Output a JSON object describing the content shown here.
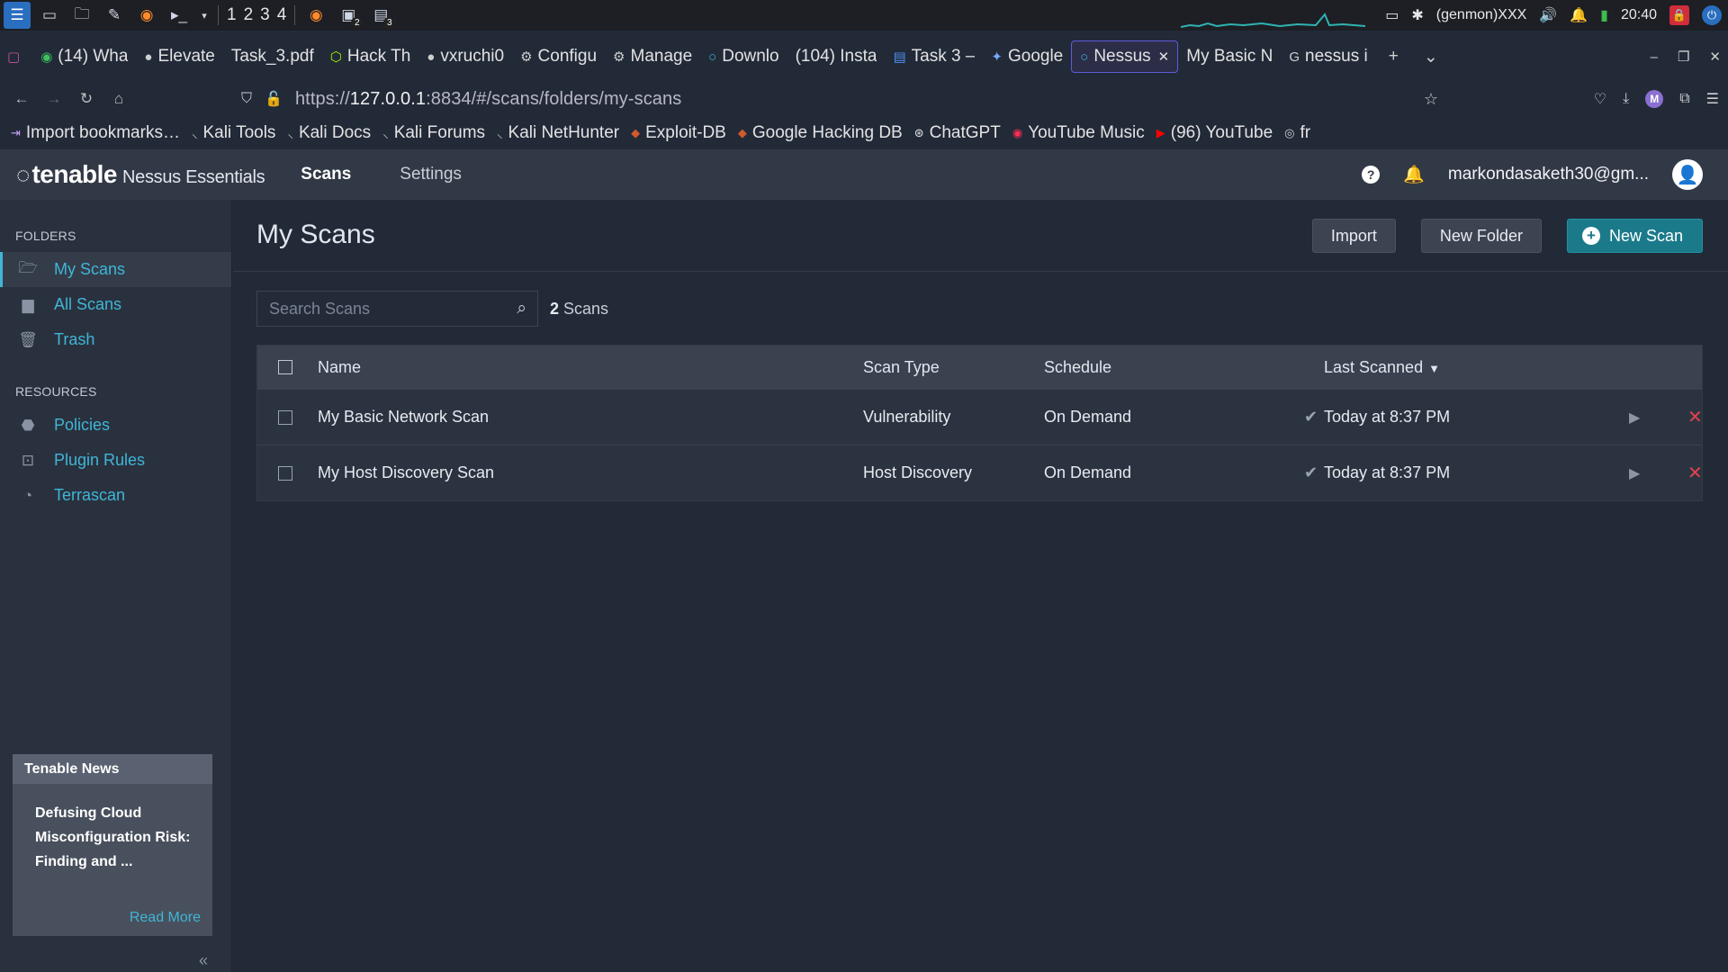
{
  "taskbar": {
    "workspaces": [
      "1",
      "2",
      "3",
      "4"
    ],
    "genmon": "(genmon)XXX",
    "clock": "20:40",
    "terminal_badge": "2",
    "files_badge": "3"
  },
  "tabs": [
    {
      "label": "(14) Wha",
      "icon": "whatsapp-icon"
    },
    {
      "label": "Elevate",
      "icon": "github-icon"
    },
    {
      "label": "Task_3.pdf",
      "icon": "pdf-icon"
    },
    {
      "label": "Hack Th",
      "icon": "hackthebox-icon"
    },
    {
      "label": "vxruchi0",
      "icon": "github-icon"
    },
    {
      "label": "Configu",
      "icon": "gear-icon"
    },
    {
      "label": "Manage",
      "icon": "gear-icon"
    },
    {
      "label": "Downlo",
      "icon": "nessus-icon"
    },
    {
      "label": "(104) Insta",
      "icon": "instagram-icon"
    },
    {
      "label": "Task 3 –",
      "icon": "docs-icon"
    },
    {
      "label": "Google",
      "icon": "gemini-icon"
    },
    {
      "label": "Nessus",
      "icon": "nessus-icon",
      "active": true
    },
    {
      "label": "My Basic N",
      "icon": ""
    },
    {
      "label": "nessus i",
      "icon": "google-icon"
    }
  ],
  "url": {
    "prefix": "https://",
    "host": "127.0.0.1",
    "rest": ":8834/#/scans/folders/my-scans"
  },
  "bookmarks": [
    "Import bookmarks…",
    "Kali Tools",
    "Kali Docs",
    "Kali Forums",
    "Kali NetHunter",
    "Exploit-DB",
    "Google Hacking DB",
    "ChatGPT",
    "YouTube Music",
    "(96) YouTube",
    "fr"
  ],
  "app": {
    "brand": "tenable",
    "product": "Nessus Essentials",
    "nav": {
      "scans": "Scans",
      "settings": "Settings"
    },
    "user_email": "markondasaketh30@gm..."
  },
  "sidebar": {
    "folders_heading": "FOLDERS",
    "folders": [
      {
        "label": "My Scans",
        "icon": "folder-open-icon"
      },
      {
        "label": "All Scans",
        "icon": "folder-icon"
      },
      {
        "label": "Trash",
        "icon": "trash-icon"
      }
    ],
    "resources_heading": "RESOURCES",
    "resources": [
      {
        "label": "Policies",
        "icon": "policy-icon"
      },
      {
        "label": "Plugin Rules",
        "icon": "plugin-rules-icon"
      },
      {
        "label": "Terrascan",
        "icon": "terrascan-icon"
      }
    ],
    "news": {
      "heading": "Tenable News",
      "title": "Defusing Cloud Misconfiguration Risk: Finding and ...",
      "read_more": "Read More"
    }
  },
  "main": {
    "title": "My Scans",
    "buttons": {
      "import": "Import",
      "new_folder": "New Folder",
      "new_scan": "New Scan"
    },
    "search_placeholder": "Search Scans",
    "count_number": "2",
    "count_label": "Scans",
    "table": {
      "headers": {
        "name": "Name",
        "type": "Scan Type",
        "schedule": "Schedule",
        "last": "Last Scanned"
      },
      "rows": [
        {
          "name": "My Basic Network Scan",
          "type": "Vulnerability",
          "schedule": "On Demand",
          "last": "Today at 8:37 PM"
        },
        {
          "name": "My Host Discovery Scan",
          "type": "Host Discovery",
          "schedule": "On Demand",
          "last": "Today at 8:37 PM"
        }
      ]
    }
  },
  "colors": {
    "accent": "#3fb6d6",
    "primary_button": "#1b7a8a",
    "delete": "#e0444a",
    "header": "#323946"
  }
}
